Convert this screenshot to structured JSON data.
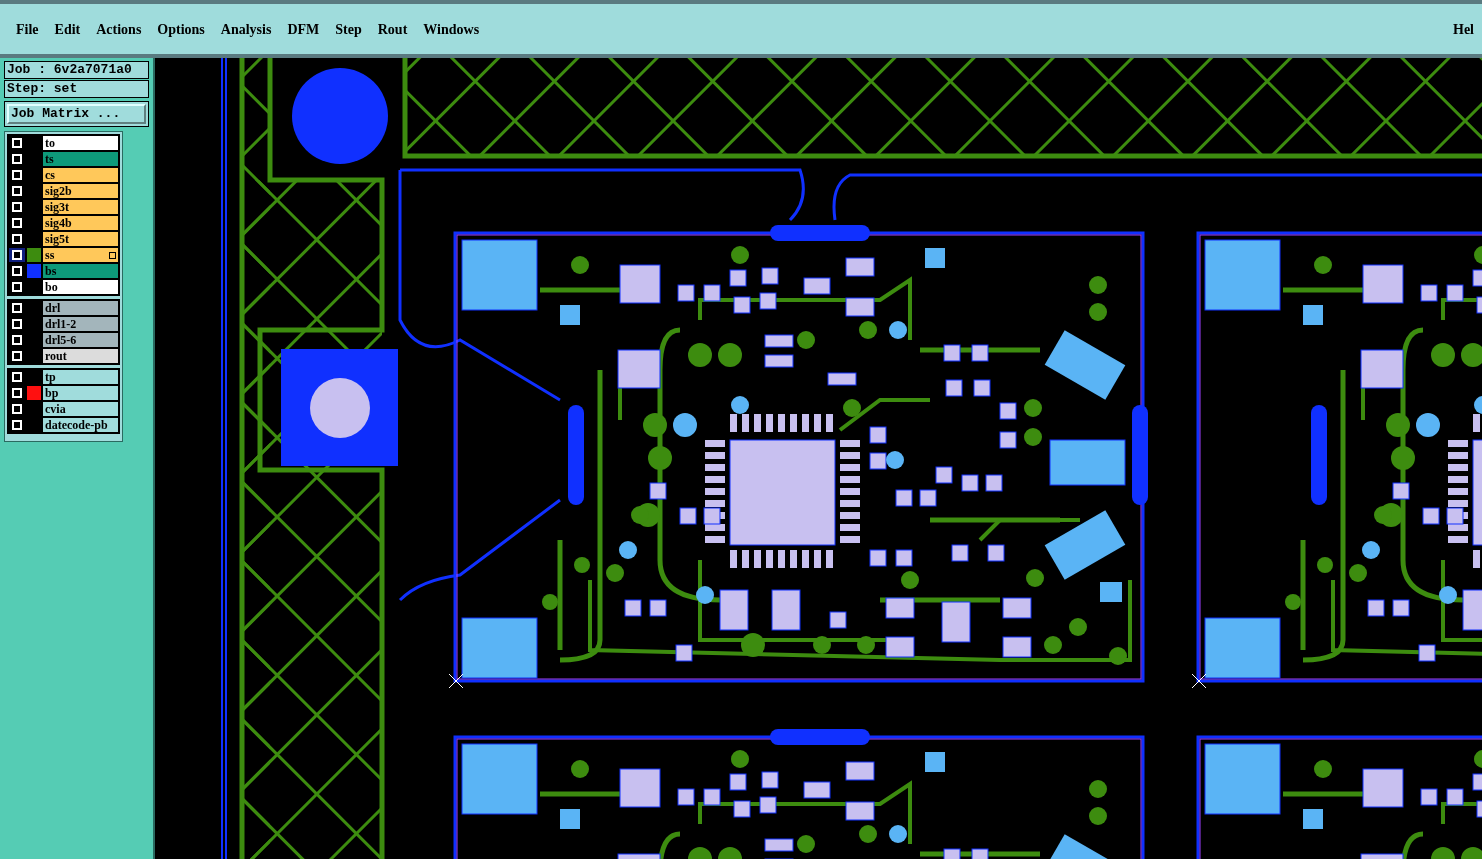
{
  "menu": [
    "File",
    "Edit",
    "Actions",
    "Options",
    "Analysis",
    "DFM",
    "Step",
    "Rout",
    "Windows",
    "Hel"
  ],
  "job": "Job : 6v2a7071a0",
  "step": "Step: set",
  "job_matrix_button": "Job Matrix ...",
  "layer_groups": [
    [
      {
        "name": "to",
        "kind": "silk",
        "selected": false
      },
      {
        "name": "ts",
        "kind": "mask",
        "selected": false
      },
      {
        "name": "cs",
        "kind": "signal",
        "selected": false
      },
      {
        "name": "sig2b",
        "kind": "signal",
        "selected": false
      },
      {
        "name": "sig3t",
        "kind": "signal",
        "selected": false
      },
      {
        "name": "sig4b",
        "kind": "signal",
        "selected": false
      },
      {
        "name": "sig5t",
        "kind": "signal",
        "selected": false
      },
      {
        "name": "ss",
        "kind": "signal",
        "color": "#3d8c0f",
        "selected": true
      },
      {
        "name": "bs",
        "kind": "mask",
        "color": "#1030ff",
        "selected": false
      },
      {
        "name": "bo",
        "kind": "silk",
        "selected": false
      }
    ],
    [
      {
        "name": "drl",
        "kind": "drill",
        "selected": false
      },
      {
        "name": "drl1-2",
        "kind": "drill",
        "selected": false
      },
      {
        "name": "drl5-6",
        "kind": "drill",
        "selected": false
      },
      {
        "name": "rout",
        "kind": "rout",
        "selected": false
      }
    ],
    [
      {
        "name": "tp",
        "kind": "document",
        "selected": false
      },
      {
        "name": "bp",
        "kind": "document",
        "color": "#ff1010",
        "selected": false
      },
      {
        "name": "cvia",
        "kind": "document",
        "selected": false
      },
      {
        "name": "datecode-pb",
        "kind": "document",
        "selected": false
      }
    ]
  ]
}
